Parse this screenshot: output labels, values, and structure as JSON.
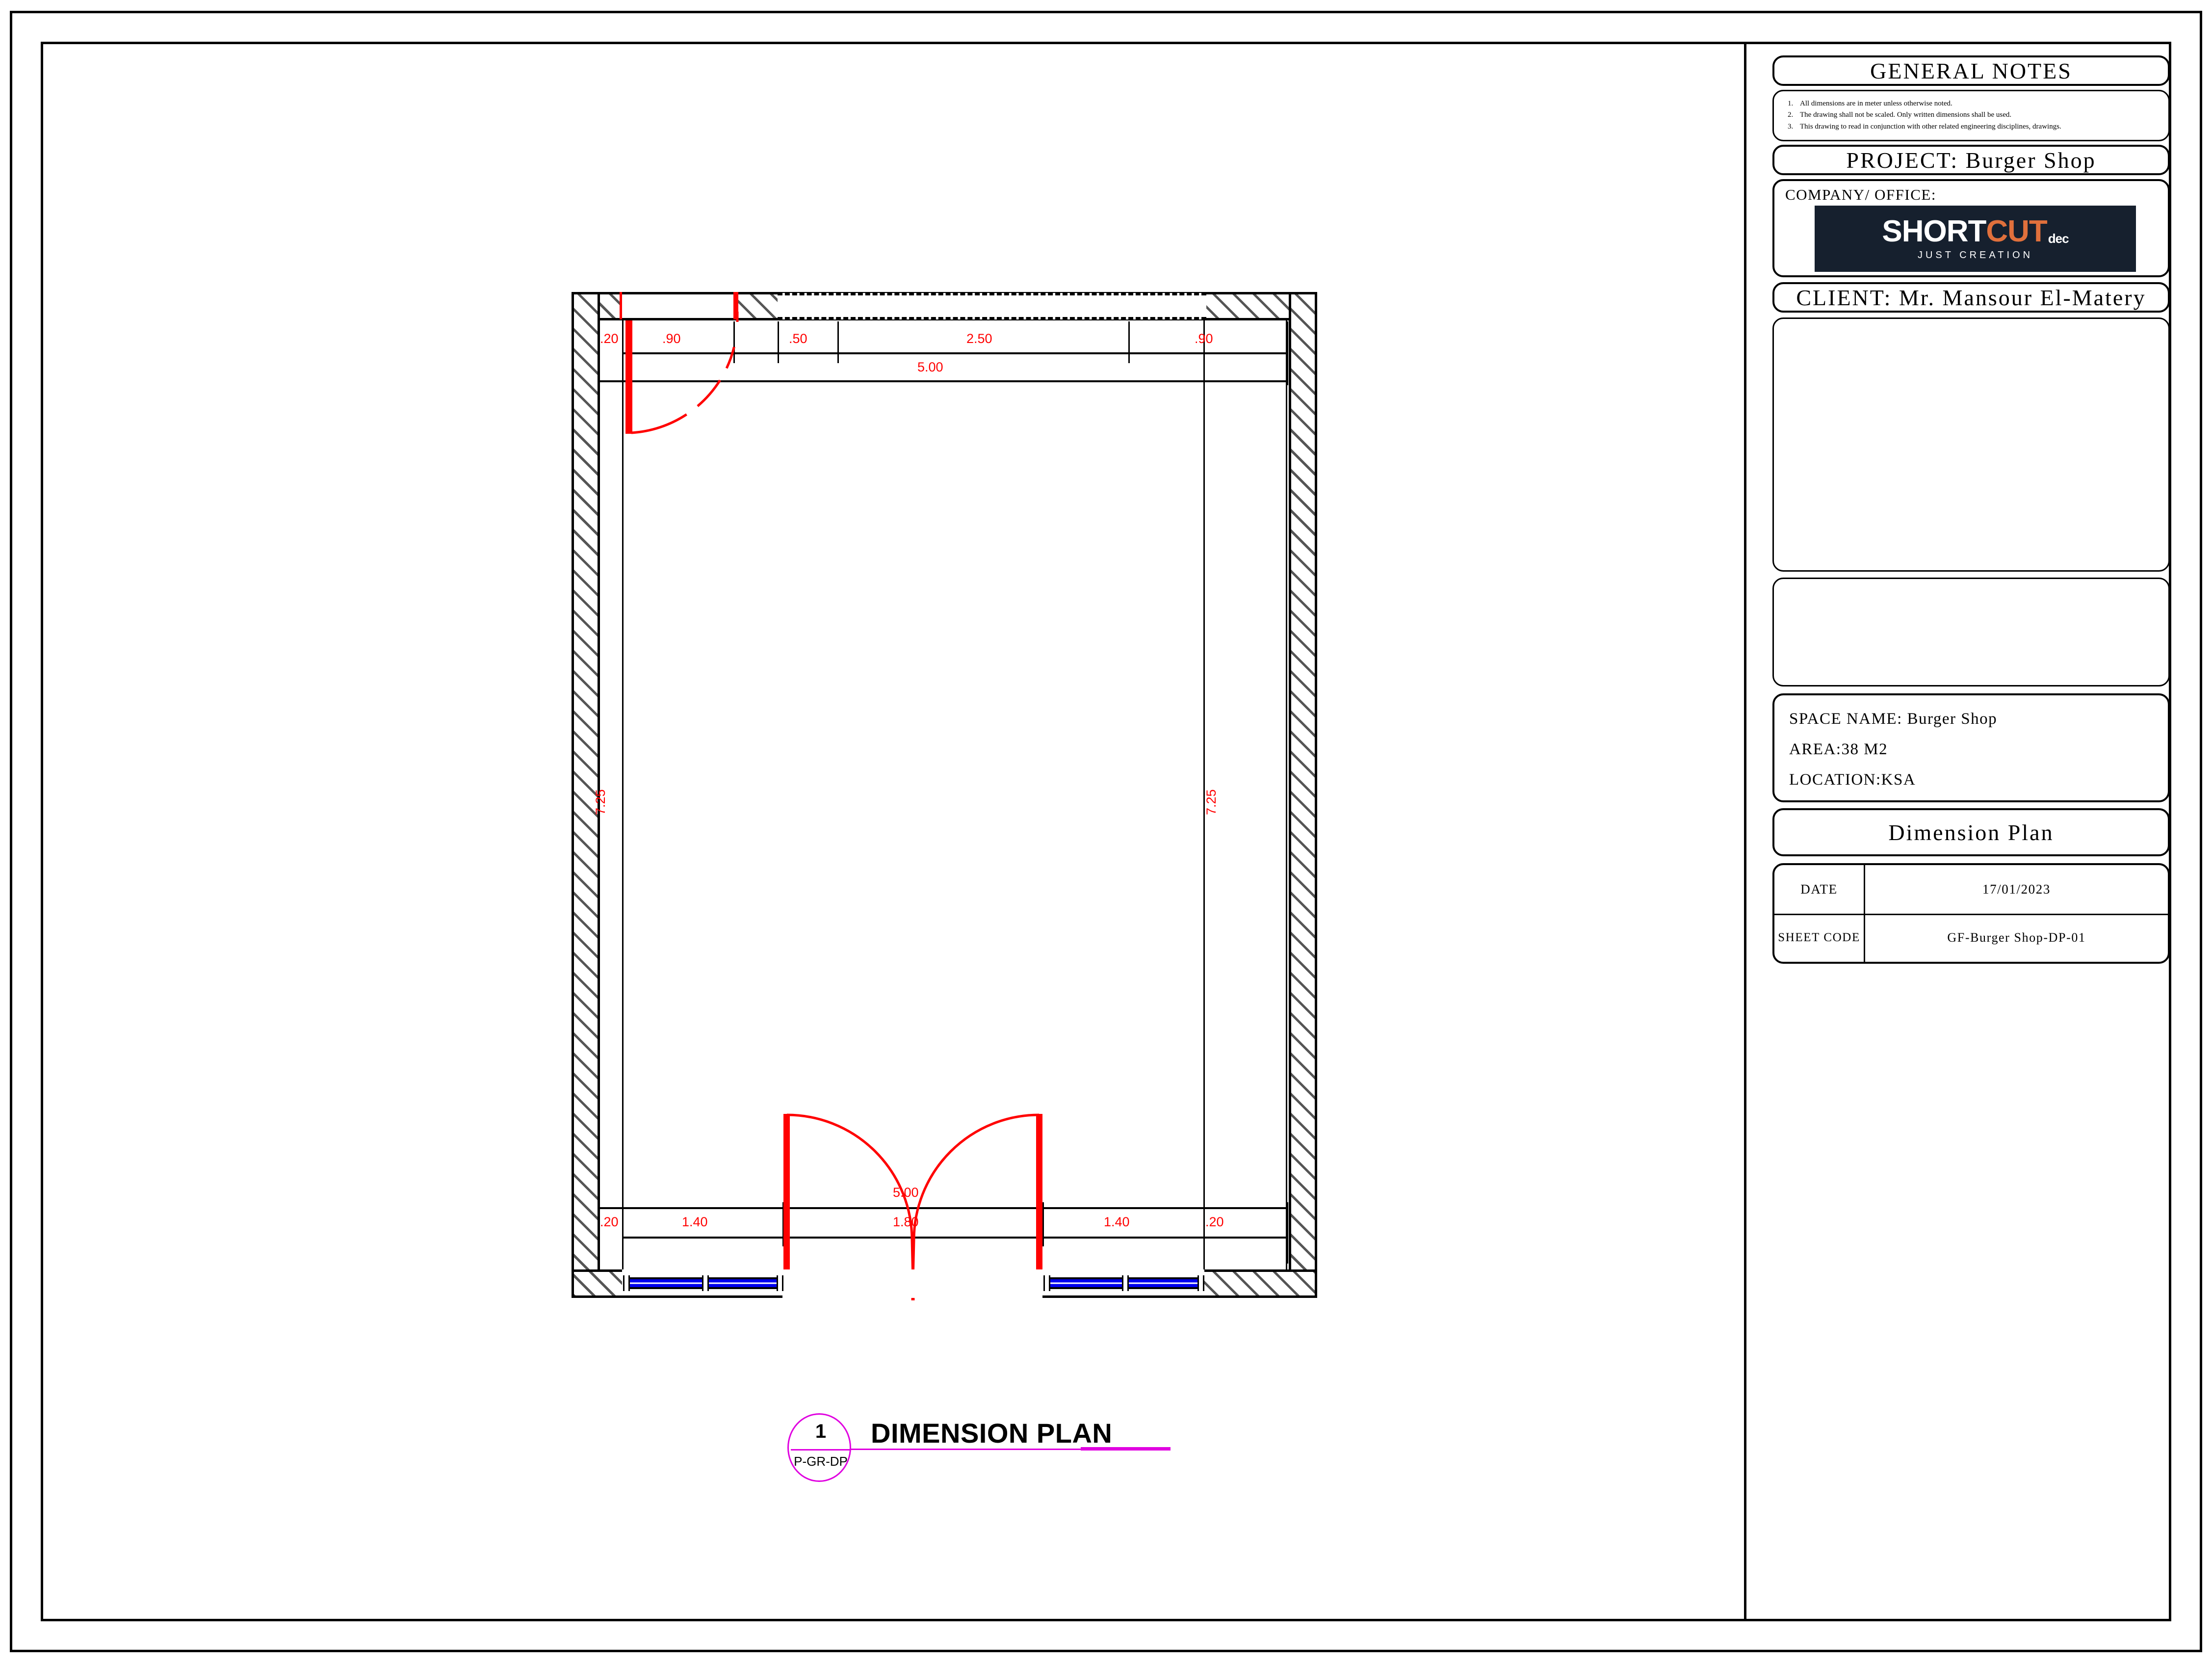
{
  "sheet": {
    "title_block": {
      "general_notes_header": "GENERAL  NOTES",
      "notes": [
        {
          "num": "1.",
          "text": "All dimensions are in meter unless otherwise noted."
        },
        {
          "num": "2.",
          "text": "The drawing shall not be scaled. Only written dimensions shall be used."
        },
        {
          "num": "3.",
          "text": "This drawing to read in conjunction with other related engineering disciplines, drawings."
        }
      ],
      "project": "PROJECT:  Burger Shop",
      "company_label": "COMPANY/  OFFICE:",
      "logo": {
        "part_white": "SHORT",
        "part_orange": "CUT",
        "suffix": "dec",
        "tagline": "JUST CREATION",
        "bg_color": "#16202e",
        "accent_color": "#e0703c"
      },
      "client": "CLIENT: Mr. Mansour El-Matery",
      "space_name": "SPACE NAME: Burger Shop",
      "area": "AREA:38 M2",
      "location": "LOCATION:KSA",
      "sheet_title": "Dimension Plan",
      "table": {
        "date_label": "DATE",
        "date_value": "17/01/2023",
        "sheet_code_label": "SHEET CODE",
        "sheet_code_value": "GF-Burger Shop-DP-01"
      }
    },
    "drawing_title": {
      "tag_number": "1",
      "tag_code": "P-GR-DP",
      "title": "DIMENSION PLAN",
      "tag_color": "#e000e0"
    },
    "plan": {
      "dimension_color": "#ff0000",
      "glazing_color": "#0000ee",
      "top_dimensions": [
        ".20",
        ".90",
        ".50",
        "2.50",
        ".90"
      ],
      "top_overall": "5.00",
      "bottom_dimensions": [
        ".20",
        "1.40",
        "1.80",
        "1.40",
        ".20"
      ],
      "bottom_overall": "5.00",
      "left_vertical": "7.25",
      "right_vertical": "7.25"
    }
  }
}
